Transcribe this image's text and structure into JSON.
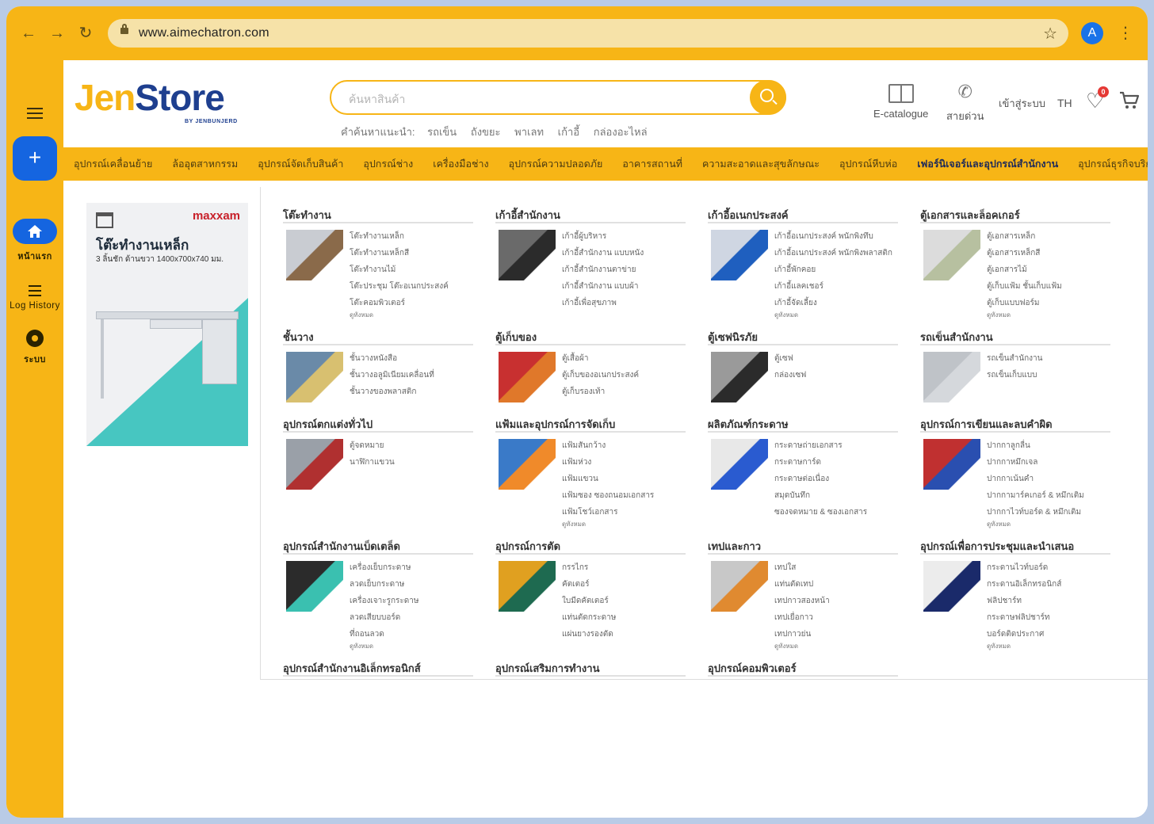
{
  "browser": {
    "url": "www.aimechatron.com",
    "profile_initial": "A"
  },
  "sidebar": {
    "new_label": "+",
    "items": [
      {
        "label": "หน้าแรก",
        "icon": "home-icon"
      },
      {
        "label": "Log History",
        "icon": "list-icon"
      },
      {
        "label": "ระบบ",
        "icon": "gear-icon"
      }
    ]
  },
  "header": {
    "logo_main_1": "Jen",
    "logo_main_2": "Store",
    "logo_sub": "BY JENBUNJERD",
    "search_placeholder": "ค้นหาสินค้า",
    "suggest_label": "คำค้นหาแนะนำ:",
    "suggestions": [
      "รถเข็น",
      "ถังขยะ",
      "พาเลท",
      "เก้าอี้",
      "กล่องอะไหล่"
    ],
    "ecatalogue": "E-catalogue",
    "hotline": "สายด่วน",
    "login": "เข้าสู่ระบบ",
    "lang": "TH",
    "wishlist_count": "0"
  },
  "categories": [
    "อุปกรณ์เคลื่อนย้าย",
    "ล้ออุตสาหกรรม",
    "อุปกรณ์จัดเก็บสินค้า",
    "อุปกรณ์ช่าง",
    "เครื่องมือช่าง",
    "อุปกรณ์ความปลอดภัย",
    "อาคารสถานที่",
    "ความสะอาดและสุขลักษณะ",
    "อุปกรณ์หีบห่อ",
    "เฟอร์นิเจอร์และอุปกรณ์สำนักงาน",
    "อุปกรณ์ธุรกิจบริการและอาหาร"
  ],
  "active_category_index": 9,
  "promo": {
    "brand": "maxxam",
    "title": "โต๊ะทำงานเหล็ก",
    "subtitle": "3 ลิ้นชัก ด้านขวา 1400x700x740 มม."
  },
  "sections": [
    {
      "title": "โต๊ะทำงาน",
      "links": [
        "โต๊ะทำงานเหล็ก",
        "โต๊ะทำงานเหล็กสี",
        "โต๊ะทำงานไม้",
        "โต๊ะประชุม โต๊ะอเนกประสงค์",
        "โต๊ะคอมพิวเตอร์"
      ],
      "all": "ดูทั้งหมด"
    },
    {
      "title": "เก้าอี้สำนักงาน",
      "links": [
        "เก้าอี้ผู้บริหาร",
        "เก้าอี้สำนักงาน แบบหนัง",
        "เก้าอี้สำนักงานตาข่าย",
        "เก้าอี้สำนักงาน แบบผ้า",
        "เก้าอี้เพื่อสุขภาพ"
      ],
      "all": ""
    },
    {
      "title": "เก้าอี้อเนกประสงค์",
      "links": [
        "เก้าอี้อเนกประสงค์ พนักพิงทึบ",
        "เก้าอี้อเนกประสงค์ พนักพิงพลาสติก",
        "เก้าอี้พักคอย",
        "เก้าอี้แลคเชอร์",
        "เก้าอี้จัดเลี้ยง"
      ],
      "all": "ดูทั้งหมด"
    },
    {
      "title": "ตู้เอกสารและล็อคเกอร์",
      "links": [
        "ตู้เอกสารเหล็ก",
        "ตู้เอกสารเหล็กสี",
        "ตู้เอกสารไม้",
        "ตู้เก็บแฟ้ม ชั้นเก็บแฟ้ม",
        "ตู้เก็บแบบฟอร์ม"
      ],
      "all": "ดูทั้งหมด"
    },
    {
      "title": "ชั้นวาง",
      "links": [
        "ชั้นวางหนังสือ",
        "ชั้นวางอลูมิเนียมเคลื่อนที่",
        "ชั้นวางของพลาสติก"
      ],
      "all": ""
    },
    {
      "title": "ตู้เก็บของ",
      "links": [
        "ตู้เสื้อผ้า",
        "ตู้เก็บของอเนกประสงค์",
        "ตู้เก็บรองเท้า"
      ],
      "all": ""
    },
    {
      "title": "ตู้เซฟนิรภัย",
      "links": [
        "ตู้เซฟ",
        "กล่องเซฟ"
      ],
      "all": ""
    },
    {
      "title": "รถเข็นสำนักงาน",
      "links": [
        "รถเข็นสำนักงาน",
        "รถเข็นเก็บแบบ"
      ],
      "all": ""
    },
    {
      "title": "อุปกรณ์ตกแต่งทั่วไป",
      "links": [
        "ตู้จดหมาย",
        "นาฬิกาแขวน"
      ],
      "all": ""
    },
    {
      "title": "แฟ้มและอุปกรณ์การจัดเก็บ",
      "links": [
        "แฟ้มสันกว้าง",
        "แฟ้มห่วง",
        "แฟ้มแขวน",
        "แฟ้มซอง ซองถนอมเอกสาร",
        "แฟ้มโชว์เอกสาร"
      ],
      "all": "ดูทั้งหมด"
    },
    {
      "title": "ผลิตภัณฑ์กระดาษ",
      "links": [
        "กระดาษถ่ายเอกสาร",
        "กระดาษการ์ด",
        "กระดาษต่อเนื่อง",
        "สมุดบันทึก",
        "ซองจดหมาย & ซองเอกสาร"
      ],
      "all": ""
    },
    {
      "title": "อุปกรณ์การเขียนและลบคำผิด",
      "links": [
        "ปากกาลูกลื่น",
        "ปากกาหมึกเจล",
        "ปากกาเน้นคำ",
        "ปากกามาร์คเกอร์ & หมึกเติม",
        "ปากกาไวท์บอร์ด & หมึกเติม"
      ],
      "all": "ดูทั้งหมด"
    },
    {
      "title": "อุปกรณ์สำนักงานเบ็ดเตล็ด",
      "links": [
        "เครื่องเย็บกระดาษ",
        "ลวดเย็บกระดาษ",
        "เครื่องเจาะรูกระดาษ",
        "ลวดเสียบบอร์ด",
        "ที่ถอนลวด"
      ],
      "all": "ดูทั้งหมด"
    },
    {
      "title": "อุปกรณ์การตัด",
      "links": [
        "กรรไกร",
        "คัตเตอร์",
        "ใบมีดคัตเตอร์",
        "แท่นตัดกระดาษ",
        "แผ่นยางรองตัด"
      ],
      "all": ""
    },
    {
      "title": "เทปและกาว",
      "links": [
        "เทปใส",
        "แท่นตัดเทป",
        "เทปกาวสองหน้า",
        "เทปเยื่อกาว",
        "เทปกาวย่น"
      ],
      "all": "ดูทั้งหมด"
    },
    {
      "title": "อุปกรณ์เพื่อการประชุมและนำเสนอ",
      "links": [
        "กระดานไวท์บอร์ด",
        "กระดานอิเล็กทรอนิกส์",
        "ฟลิปชาร์ท",
        "กระดาษฟลิปชาร์ท",
        "บอร์ดติดประกาศ"
      ],
      "all": "ดูทั้งหมด"
    },
    {
      "title": "อุปกรณ์สำนักงานอิเล็กทรอนิกส์",
      "links": [],
      "all": ""
    },
    {
      "title": "อุปกรณ์เสริมการทำงาน",
      "links": [],
      "all": ""
    },
    {
      "title": "อุปกรณ์คอมพิวเตอร์",
      "links": [],
      "all": ""
    }
  ]
}
